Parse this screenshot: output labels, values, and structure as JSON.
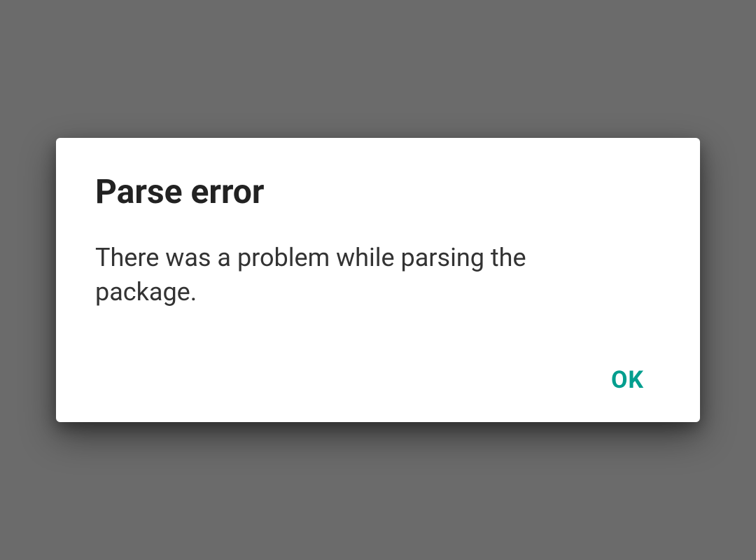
{
  "dialog": {
    "title": "Parse error",
    "message": "There was a problem while parsing the package.",
    "actions": {
      "ok_label": "OK"
    }
  },
  "colors": {
    "accent": "#009e8e",
    "backdrop": "#6b6b6b",
    "surface": "#ffffff",
    "text_primary": "#222222",
    "text_body": "#333333"
  }
}
